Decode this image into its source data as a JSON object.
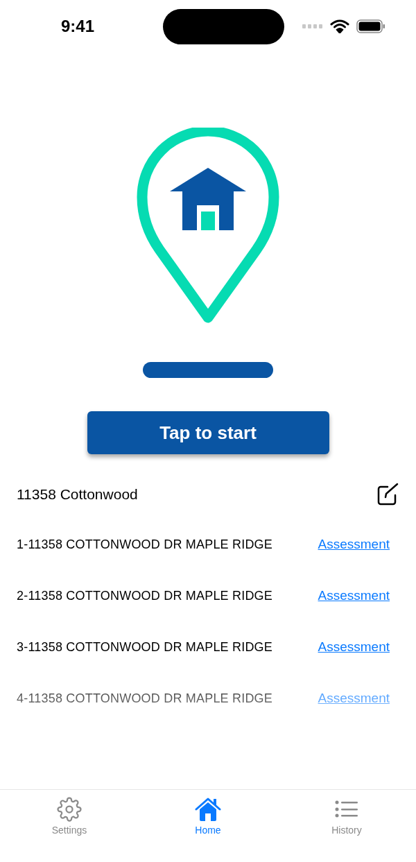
{
  "status_bar": {
    "time": "9:41"
  },
  "start_button": {
    "label": "Tap to start"
  },
  "address_header": {
    "title": "11358 Cottonwood"
  },
  "addresses": [
    {
      "address": "1-11358 COTTONWOOD DR MAPLE RIDGE",
      "link": "Assessment"
    },
    {
      "address": "2-11358 COTTONWOOD DR MAPLE RIDGE",
      "link": "Assessment"
    },
    {
      "address": "3-11358 COTTONWOOD DR MAPLE RIDGE",
      "link": "Assessment"
    },
    {
      "address": "4-11358 COTTONWOOD DR MAPLE RIDGE",
      "link": "Assessment"
    }
  ],
  "tab_bar": [
    {
      "label": "Settings",
      "kind": "settings",
      "selected": false
    },
    {
      "label": "Home",
      "kind": "home",
      "selected": true
    },
    {
      "label": "History",
      "kind": "history",
      "selected": false
    }
  ]
}
